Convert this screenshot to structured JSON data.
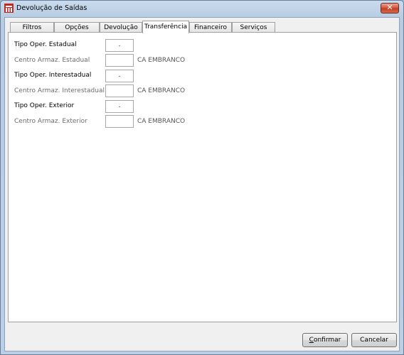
{
  "window": {
    "title": "Devolução de Saídas",
    "close_glyph": "✕",
    "app_icon": "app-logo-icon"
  },
  "tabs": [
    {
      "label": "Filtros"
    },
    {
      "label": "Opções"
    },
    {
      "label": "Devolução"
    },
    {
      "label": "Transferência",
      "active": true
    },
    {
      "label": "Financeiro"
    },
    {
      "label": "Serviços"
    }
  ],
  "transferencia": {
    "tipo_estadual": {
      "label": "Tipo Oper. Estadual",
      "value": "."
    },
    "centro_estadual": {
      "label": "Centro Armaz. Estadual",
      "value": "",
      "desc": "CA EMBRANCO"
    },
    "tipo_interestadual": {
      "label": "Tipo Oper. Interestadual",
      "value": "."
    },
    "centro_interestadual": {
      "label": "Centro Armaz. Interestadual",
      "value": "",
      "desc": "CA EMBRANCO"
    },
    "tipo_exterior": {
      "label": "Tipo Oper. Exterior",
      "value": "."
    },
    "centro_exterior": {
      "label": "Centro Armaz. Exterior",
      "value": "",
      "desc": "CA EMBRANCO"
    }
  },
  "buttons": {
    "confirm_first": "C",
    "confirm_rest": "onfirmar",
    "cancel": "Cancelar"
  },
  "colors": {
    "close_button": "#c43d21",
    "title_bar": "#b9cfe6",
    "disabled_text": "#6d6d6d"
  }
}
